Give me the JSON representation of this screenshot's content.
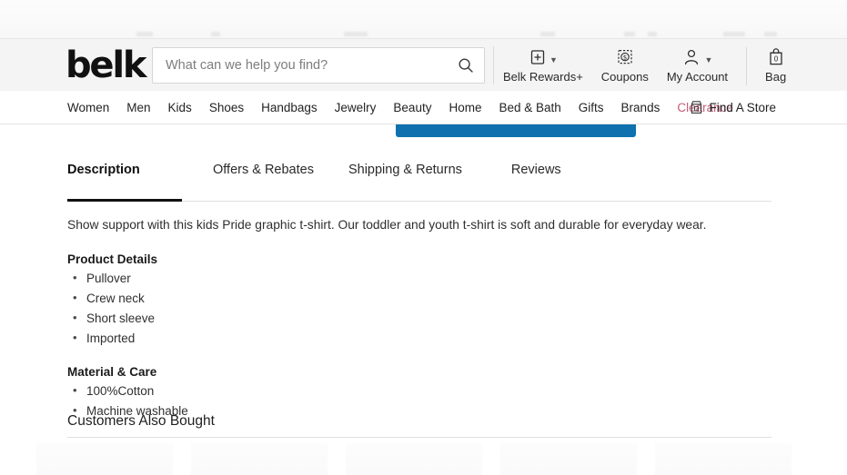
{
  "brand": {
    "logo_text": "belk",
    "clearance_color": "#c35d79",
    "cta_color": "#0f72ae",
    "accent_underline": "#111111"
  },
  "search": {
    "placeholder": "What can we help you find?",
    "value": "",
    "icon": "search-icon"
  },
  "header_actions": [
    {
      "label": "Belk Rewards+",
      "icon": "rewards-card-icon",
      "has_chevron": true
    },
    {
      "label": "Coupons",
      "icon": "coupon-dollar-icon",
      "has_chevron": false
    },
    {
      "label": "My Account",
      "icon": "account-person-icon",
      "has_chevron": true
    },
    {
      "label": "Bag",
      "icon": "shopping-bag-icon",
      "has_chevron": false,
      "count": "0"
    }
  ],
  "nav": {
    "links": [
      {
        "label": "Women",
        "highlight": false
      },
      {
        "label": "Men",
        "highlight": false
      },
      {
        "label": "Kids",
        "highlight": false
      },
      {
        "label": "Shoes",
        "highlight": false
      },
      {
        "label": "Handbags",
        "highlight": false
      },
      {
        "label": "Jewelry",
        "highlight": false
      },
      {
        "label": "Beauty",
        "highlight": false
      },
      {
        "label": "Home",
        "highlight": false
      },
      {
        "label": "Bed & Bath",
        "highlight": false
      },
      {
        "label": "Gifts",
        "highlight": false
      },
      {
        "label": "Brands",
        "highlight": false
      },
      {
        "label": "Clearance",
        "highlight": true
      }
    ],
    "find_store": {
      "label": "Find A Store",
      "icon": "store-icon"
    }
  },
  "product_tabs": [
    {
      "label": "Description",
      "active": true
    },
    {
      "label": "Offers & Rebates",
      "active": false
    },
    {
      "label": "Shipping & Returns",
      "active": false
    },
    {
      "label": "Reviews",
      "active": false
    }
  ],
  "description": {
    "intro": "Show support with this kids Pride graphic t-shirt. Our toddler and youth t-shirt is soft and durable for everyday wear.",
    "sections": [
      {
        "heading": "Product Details",
        "items": [
          "Pullover",
          "Crew neck",
          "Short sleeve",
          "Imported"
        ]
      },
      {
        "heading": "Material & Care",
        "items": [
          "100%Cotton",
          "Machine washable"
        ]
      }
    ]
  },
  "customers_also_bought": {
    "title": "Customers Also Bought"
  }
}
